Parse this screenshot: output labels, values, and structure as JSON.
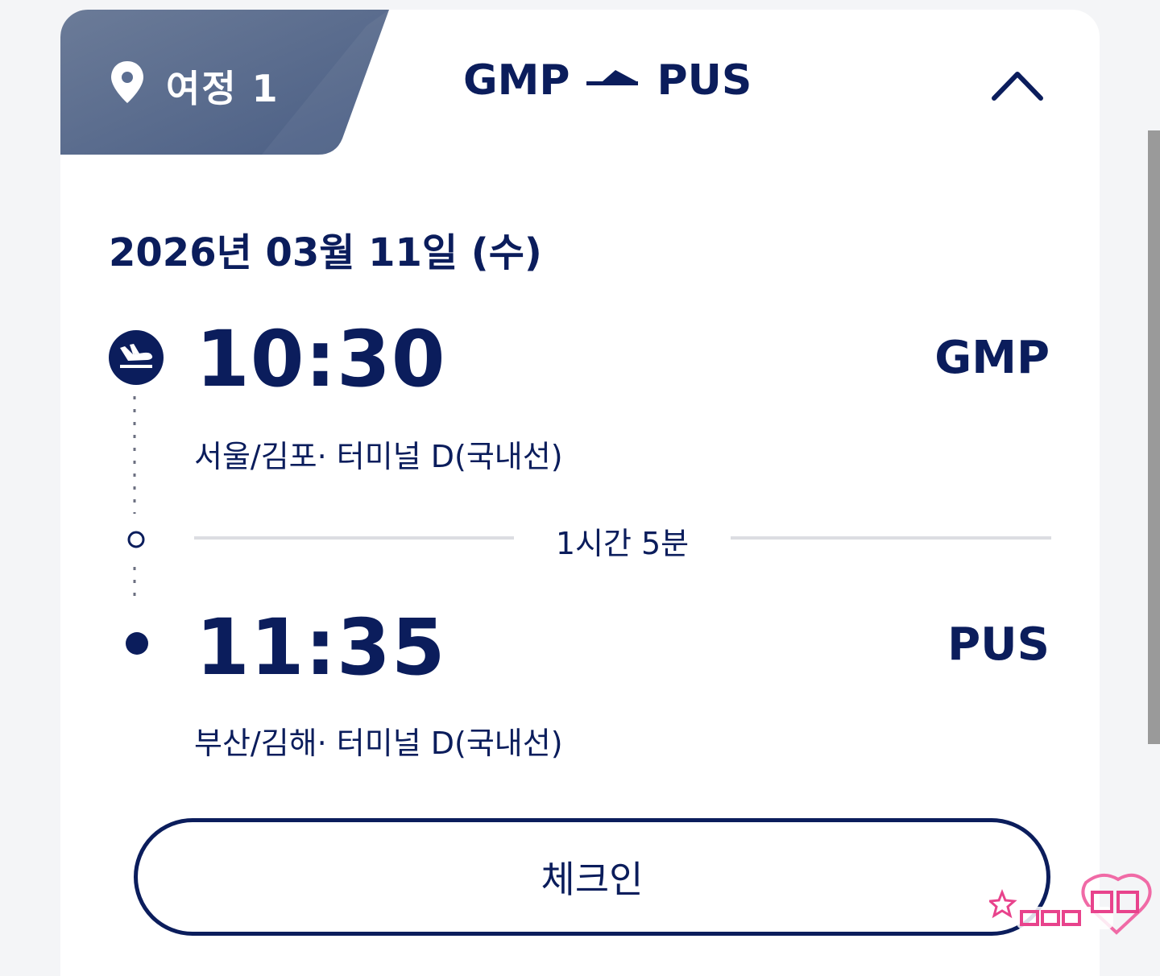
{
  "journey": {
    "tab_label": "여정 1",
    "origin": "GMP",
    "destination": "PUS",
    "collapse_icon": "chevron-up-icon"
  },
  "date": "2026년 03월 11일 (수)",
  "departure": {
    "time": "10:30",
    "code": "GMP",
    "place": "서울/김포· 터미널 D(국내선)",
    "icon": "plane-takeoff-icon"
  },
  "duration": "1시간 5분",
  "arrival": {
    "time": "11:35",
    "code": "PUS",
    "place": "부산/김해· 터미널 D(국내선)"
  },
  "checkin_button": "체크인",
  "colors": {
    "navy": "#0b1d5c",
    "tab_bg": "#5b6e92",
    "divider": "#dcdde2"
  }
}
